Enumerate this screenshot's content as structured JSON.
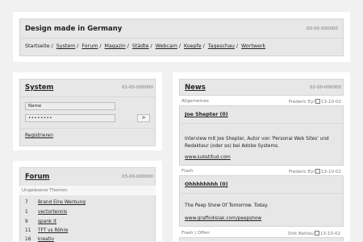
{
  "header": {
    "title": "Design made in Germany",
    "code": "00-00-000000",
    "breadcrumb": [
      {
        "label": "Startseite",
        "link": false
      },
      {
        "label": "System",
        "link": true
      },
      {
        "label": "Forum",
        "link": true
      },
      {
        "label": "Magazin",
        "link": true
      },
      {
        "label": "Städte",
        "link": true
      },
      {
        "label": "Webcam",
        "link": true
      },
      {
        "label": "Koepfe",
        "link": true
      },
      {
        "label": "Tageschau",
        "link": true
      },
      {
        "label": "Wortwerk",
        "link": true
      }
    ]
  },
  "system": {
    "title": "System",
    "code": "01-00-000000",
    "name_value": "Name",
    "password_value": "••••••••",
    "submit_label": ">",
    "register_link": "Registrieren"
  },
  "forum": {
    "title": "Forum",
    "code": "03-00-000000",
    "subtitle": "Ungelesene Themen",
    "rows": [
      {
        "num": "7",
        "topic": "Brand Eins Werbung"
      },
      {
        "num": "1",
        "topic": "vectortennis"
      },
      {
        "num": "9",
        "topic": "spank it"
      },
      {
        "num": "11",
        "topic": "TFT vs Röhre"
      },
      {
        "num": "16",
        "topic": "kreativ"
      }
    ]
  },
  "news": {
    "title": "News",
    "code": "02-00-000000",
    "items": [
      {
        "category": "Allgemeines",
        "author": "Frederic Eyl",
        "date": "13-10-02",
        "headline": "Joe Shepter (0)",
        "body": "Interview mit Joe Shepter, Autor von 'Personal Web Sites' und Redakteur (oder so) bei Adobe Systems.",
        "link": "www.substitud.com"
      },
      {
        "category": "Flash",
        "author": "Frederic Eyl",
        "date": "13-10-02",
        "headline": "Ohhhhhhhh (0)",
        "body": "The Peep Show Of Tomorrow. Today.",
        "link": "www.graffodisiak.com/peepshow"
      },
      {
        "category": "Flash | Offen",
        "author": "Dirk Behlau",
        "date": "13-10-02",
        "headline": "",
        "body": "",
        "link": ""
      }
    ]
  }
}
